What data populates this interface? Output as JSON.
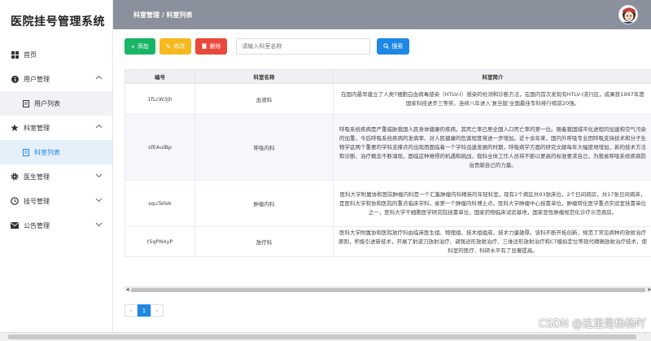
{
  "app": {
    "title": "医院挂号管理系统"
  },
  "header": {
    "breadcrumb": "科室管理 / 科室列表"
  },
  "sidebar": {
    "items": [
      {
        "label": "首页",
        "icon": "grid-icon"
      },
      {
        "label": "用户管理",
        "icon": "info-circle-icon",
        "children": [
          {
            "label": "用户列表"
          }
        ]
      },
      {
        "label": "科室管理",
        "icon": "star-icon",
        "children": [
          {
            "label": "科室列表"
          }
        ]
      },
      {
        "label": "医生管理",
        "icon": "gear-icon"
      },
      {
        "label": "挂号管理",
        "icon": "clock-icon"
      },
      {
        "label": "公告管理",
        "icon": "mail-icon"
      }
    ]
  },
  "toolbar": {
    "add_label": "添加",
    "edit_label": "修改",
    "delete_label": "删除",
    "search_placeholder": "请输入科室名称",
    "search_label": "搜索"
  },
  "table": {
    "headers": [
      "编号",
      "科室名称",
      "科室简介"
    ],
    "rows": [
      {
        "id": "1fLcW3Jh",
        "name": "血液科",
        "intro": "在国内最早建立了人类T细胞白血病毒感染（HTLV-Ⅰ）感染的检测和诊断方法，在国内首次发现有HTLV-Ⅰ流行区，成果获1997年度国家科技进步三等奖。连续八年进入'复旦版'全国最佳专科排行榜前20强。"
      },
      {
        "id": "sfEAulBp",
        "name": "呼吸内科",
        "intro": "呼吸系统疾病是严重威胁我国人民身体健康的疾病，其死亡率已居全国人口死亡率的第一位。随着我国城市化进程的加速和空气污染的加重，今后呼吸系统疾病的发病率、对人民健康的危害程度将进一步增加。近十余年来，国内外呼吸专业因呼吸支持技术和分子生物学这两个重要的学科支撑点的出现而面临着一个学科迅速发展的时期，呼吸病学方面的研究文献每年大幅度地增加，新的技术方法和诊断、治疗概念不断涌现，面临这种难得的机遇和挑战，我科全体工作人员将不断以更高的标准要求自己，为我省呼吸系统疾病防治贡献自己的力量。"
      },
      {
        "id": "squTefek",
        "name": "肿瘤内科",
        "intro": "医科大学附属协和医院肿瘤内科是一个汇集肿瘤内科精英的年轻科室。现有2个病区共93张床位，2个日间病房，共17张日间病床，是医科大学和协和医院的重点临床学科，省第一个肿瘤内科博士点，医科大学肿瘤中心挂靠单位，肿瘤转化医学重点实验室挂靠单位之一，医科大学干细胞医学研究院挂靠单位，国家药物临床试验基地，国家恶性肿瘤规范化诊疗示范病房。"
      },
      {
        "id": "t5qPN4yP",
        "name": "放疗科",
        "intro": "医科大学附属协和医院放疗科由临床医生组、物理组、技术组组成，技术力量雄厚。该科不断开拓创新，规范了常见病种的放射治疗原则，积极引进新技术，开展了射波刀放射治疗、调强适形放射治疗、三维适形放射治疗和CT模拟定位等现代精确放射治疗技术，使科室的医疗、科研水平有了显著提高。"
      }
    ]
  },
  "pager": {
    "prev": "‹",
    "current": "1",
    "next": "›"
  },
  "watermark": "CSDN @这里是杨杨吖"
}
